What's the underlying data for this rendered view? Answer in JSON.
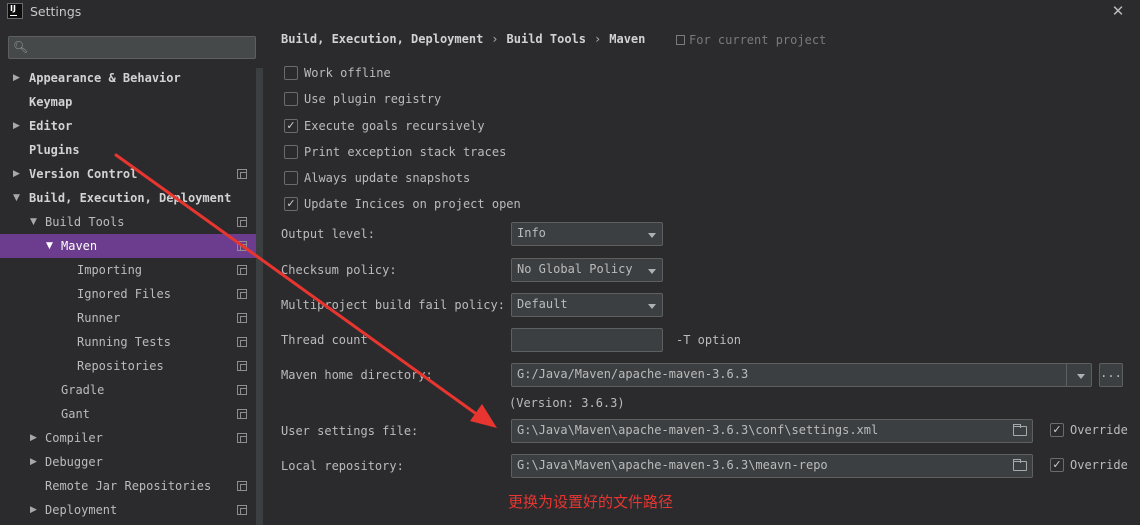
{
  "window": {
    "title": "Settings",
    "app_icon": "IJ"
  },
  "sidebar": {
    "search_placeholder": "",
    "items": [
      {
        "label": "Appearance & Behavior",
        "arrow": "▶",
        "bold": true
      },
      {
        "label": "Keymap",
        "arrow": "",
        "bold": true
      },
      {
        "label": "Editor",
        "arrow": "▶",
        "bold": true
      },
      {
        "label": "Plugins",
        "arrow": "",
        "bold": true
      },
      {
        "label": "Version Control",
        "arrow": "▶",
        "bold": true
      },
      {
        "label": "Build, Execution, Deployment",
        "arrow": "▼",
        "bold": true
      },
      {
        "label": "Build Tools",
        "arrow": "▼",
        "bold": false
      },
      {
        "label": "Maven",
        "arrow": "▼",
        "bold": false
      },
      {
        "label": "Importing",
        "arrow": "",
        "bold": false
      },
      {
        "label": "Ignored Files",
        "arrow": "",
        "bold": false
      },
      {
        "label": "Runner",
        "arrow": "",
        "bold": false
      },
      {
        "label": "Running Tests",
        "arrow": "",
        "bold": false
      },
      {
        "label": "Repositories",
        "arrow": "",
        "bold": false
      },
      {
        "label": "Gradle",
        "arrow": "",
        "bold": false
      },
      {
        "label": "Gant",
        "arrow": "",
        "bold": false
      },
      {
        "label": "Compiler",
        "arrow": "▶",
        "bold": false
      },
      {
        "label": "Debugger",
        "arrow": "▶",
        "bold": false
      },
      {
        "label": "Remote Jar Repositories",
        "arrow": "",
        "bold": false
      },
      {
        "label": "Deployment",
        "arrow": "▶",
        "bold": false
      }
    ]
  },
  "breadcrumb": {
    "items": [
      "Build, Execution, Deployment",
      "Build Tools",
      "Maven"
    ],
    "separator": "›",
    "for_project": "For current project"
  },
  "options": [
    {
      "label": "Work offline",
      "checked": false
    },
    {
      "label": "Use plugin registry",
      "checked": false
    },
    {
      "label": "Execute goals recursively",
      "checked": true
    },
    {
      "label": "Print exception stack traces",
      "checked": false
    },
    {
      "label": "Always update snapshots",
      "checked": false
    },
    {
      "label": "Update Incices on project open",
      "checked": true
    }
  ],
  "fields": {
    "output_level": {
      "label": "Output level:",
      "value": "Info"
    },
    "checksum_policy": {
      "label": "Checksum policy:",
      "value": "No Global Policy"
    },
    "multiproject_policy": {
      "label": "Multiproject build fail policy:",
      "value": "Default"
    },
    "thread_count": {
      "label": "Thread count",
      "value": "",
      "suffix": "-T option"
    },
    "maven_home": {
      "label": "Maven home directory:",
      "value": "G:/Java/Maven/apache-maven-3.6.3",
      "button": "...",
      "version": "(Version: 3.6.3)"
    },
    "user_settings": {
      "label": "User settings file:",
      "value": "G:\\Java\\Maven\\apache-maven-3.6.3\\conf\\settings.xml",
      "override_label": "Override",
      "override_checked": true
    },
    "local_repo": {
      "label": "Local repository:",
      "value": "G:\\Java\\Maven\\apache-maven-3.6.3\\meavn-repo",
      "override_label": "Override",
      "override_checked": true
    }
  },
  "annotation": {
    "text": "更换为设置好的文件路径",
    "color": "#e8352f"
  },
  "colors": {
    "selection": "#6c3d8f",
    "background": "#2b2b2e",
    "annotation_arrow": "#e8352f"
  },
  "icons": {
    "check": "✓",
    "close": "✕",
    "search": "search-icon",
    "folder": "folder-icon",
    "project": "project-scope-icon"
  }
}
